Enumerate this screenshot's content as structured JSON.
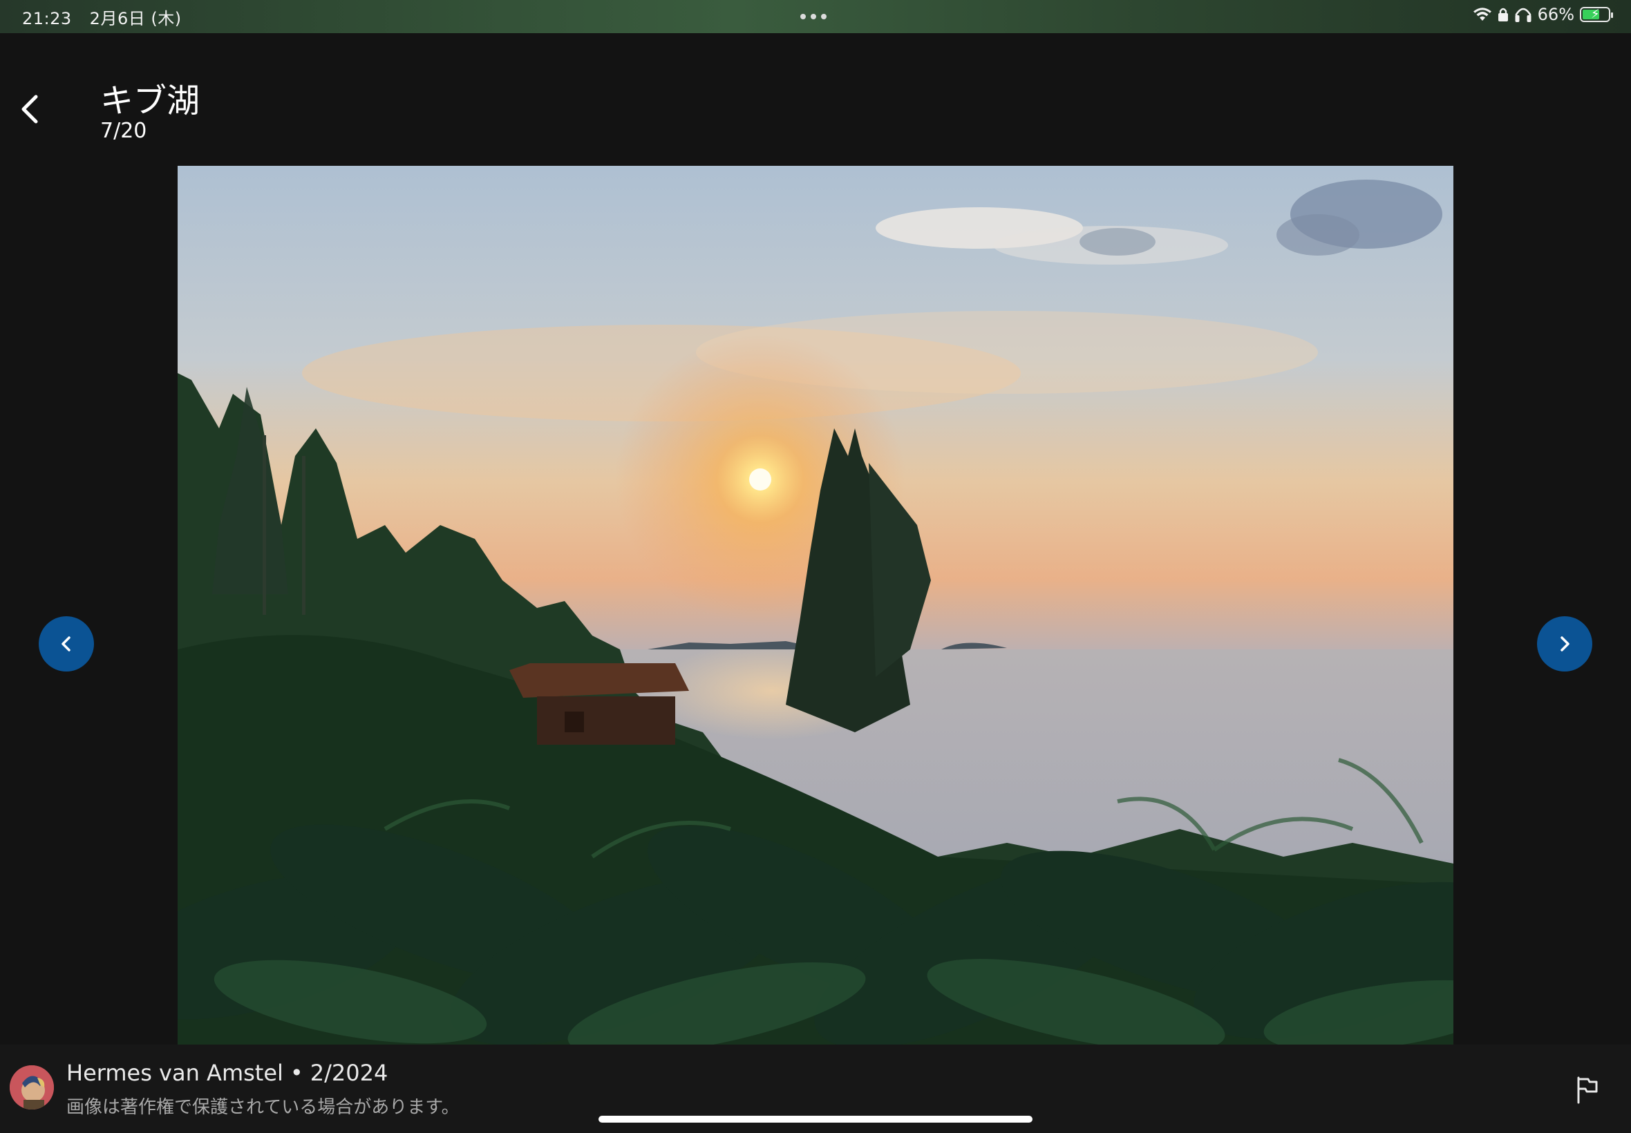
{
  "status_bar": {
    "time": "21:23",
    "date": "2月6日 (木)",
    "battery_percent": "66%",
    "battery_level": 0.66,
    "icons": [
      "wifi-icon",
      "lock-icon",
      "headphones-icon",
      "battery-icon"
    ]
  },
  "header": {
    "title": "キブ湖",
    "counter": "7/20",
    "back_icon": "chevron-left-icon"
  },
  "photo": {
    "icons": [
      "chevron-left-icon",
      "chevron-right-icon"
    ]
  },
  "footer": {
    "author": "Hermes van Amstel",
    "separator": "•",
    "date": "2/2024",
    "copyright_notice": "画像は著作権で保護されている場合があります。",
    "flag_icon": "flag-icon"
  },
  "colors": {
    "background": "#131313",
    "nav_button": "#0b5394",
    "footer": "#171717",
    "secondary_text": "#a9a9a9"
  }
}
